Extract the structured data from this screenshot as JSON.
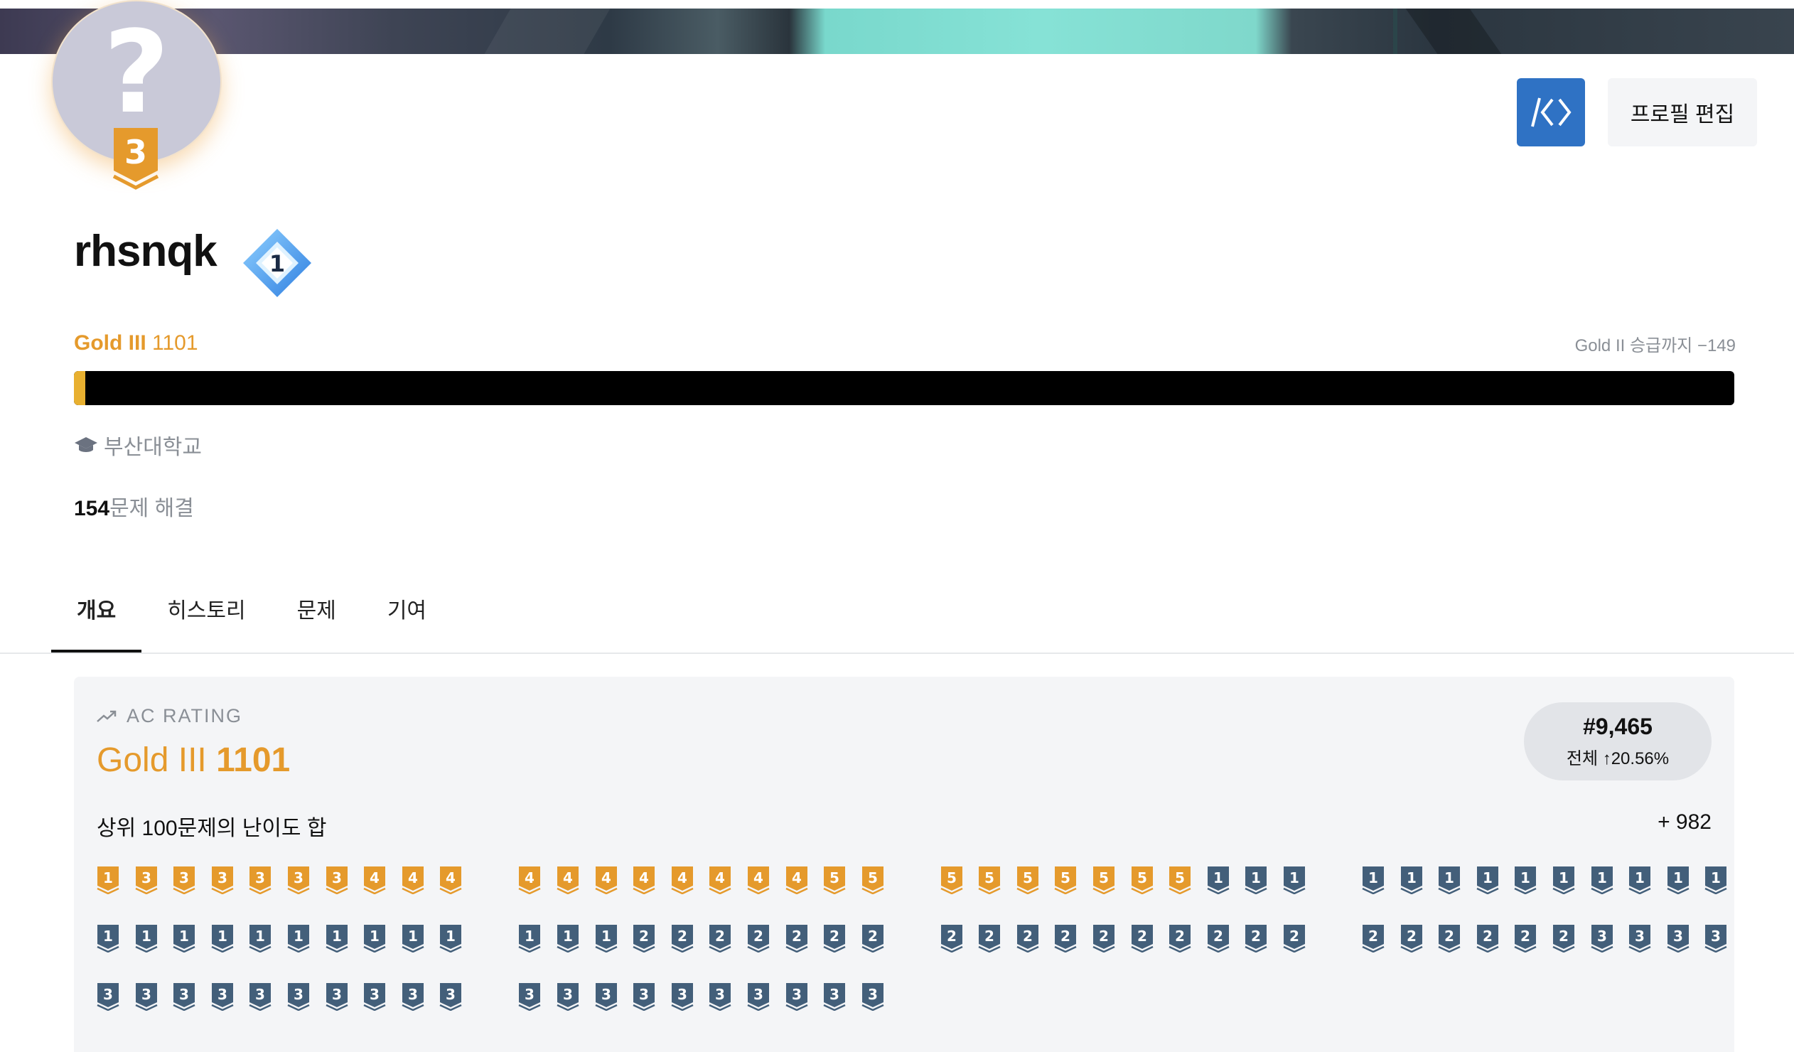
{
  "header": {
    "code_button_glyph": "/<>",
    "edit_profile_label": "프로필 편집",
    "avatar_glyph": "?",
    "avatar_tier_level": "3"
  },
  "profile": {
    "username": "rhsnqk",
    "class_level": "1",
    "tier_name": "Gold III",
    "rating": "1101",
    "next_tier_text": "Gold II 승급까지 −149",
    "progress_fraction": 0.005,
    "school": "부산대학교",
    "solved_count": "154",
    "solved_suffix": "문제 해결"
  },
  "tabs": [
    {
      "label": "개요",
      "active": true
    },
    {
      "label": "히스토리",
      "active": false
    },
    {
      "label": "문제",
      "active": false
    },
    {
      "label": "기여",
      "active": false
    }
  ],
  "ac_card": {
    "section_label": "AC RATING",
    "tier_name": "Gold III",
    "rating": "1101",
    "rank": "#9,465",
    "rank_sub": "전체 ↑20.56%",
    "sum_label": "상위 100문제의 난이도 합",
    "sum_value": "+ 982"
  },
  "colors": {
    "gold": "#e59a2c",
    "silver": "#435f7a",
    "accent_blue": "#2f72c4"
  },
  "badge_rows": [
    [
      [
        [
          "gold",
          "1"
        ],
        [
          "gold",
          "3"
        ],
        [
          "gold",
          "3"
        ],
        [
          "gold",
          "3"
        ],
        [
          "gold",
          "3"
        ],
        [
          "gold",
          "3"
        ],
        [
          "gold",
          "3"
        ],
        [
          "gold",
          "4"
        ],
        [
          "gold",
          "4"
        ],
        [
          "gold",
          "4"
        ]
      ],
      [
        [
          "gold",
          "4"
        ],
        [
          "gold",
          "4"
        ],
        [
          "gold",
          "4"
        ],
        [
          "gold",
          "4"
        ],
        [
          "gold",
          "4"
        ],
        [
          "gold",
          "4"
        ],
        [
          "gold",
          "4"
        ],
        [
          "gold",
          "4"
        ],
        [
          "gold",
          "5"
        ],
        [
          "gold",
          "5"
        ]
      ],
      [
        [
          "gold",
          "5"
        ],
        [
          "gold",
          "5"
        ],
        [
          "gold",
          "5"
        ],
        [
          "gold",
          "5"
        ],
        [
          "gold",
          "5"
        ],
        [
          "gold",
          "5"
        ],
        [
          "gold",
          "5"
        ],
        [
          "silver",
          "1"
        ],
        [
          "silver",
          "1"
        ],
        [
          "silver",
          "1"
        ]
      ],
      [
        [
          "silver",
          "1"
        ],
        [
          "silver",
          "1"
        ],
        [
          "silver",
          "1"
        ],
        [
          "silver",
          "1"
        ],
        [
          "silver",
          "1"
        ],
        [
          "silver",
          "1"
        ],
        [
          "silver",
          "1"
        ],
        [
          "silver",
          "1"
        ],
        [
          "silver",
          "1"
        ],
        [
          "silver",
          "1"
        ]
      ]
    ],
    [
      [
        [
          "silver",
          "1"
        ],
        [
          "silver",
          "1"
        ],
        [
          "silver",
          "1"
        ],
        [
          "silver",
          "1"
        ],
        [
          "silver",
          "1"
        ],
        [
          "silver",
          "1"
        ],
        [
          "silver",
          "1"
        ],
        [
          "silver",
          "1"
        ],
        [
          "silver",
          "1"
        ],
        [
          "silver",
          "1"
        ]
      ],
      [
        [
          "silver",
          "1"
        ],
        [
          "silver",
          "1"
        ],
        [
          "silver",
          "1"
        ],
        [
          "silver",
          "2"
        ],
        [
          "silver",
          "2"
        ],
        [
          "silver",
          "2"
        ],
        [
          "silver",
          "2"
        ],
        [
          "silver",
          "2"
        ],
        [
          "silver",
          "2"
        ],
        [
          "silver",
          "2"
        ]
      ],
      [
        [
          "silver",
          "2"
        ],
        [
          "silver",
          "2"
        ],
        [
          "silver",
          "2"
        ],
        [
          "silver",
          "2"
        ],
        [
          "silver",
          "2"
        ],
        [
          "silver",
          "2"
        ],
        [
          "silver",
          "2"
        ],
        [
          "silver",
          "2"
        ],
        [
          "silver",
          "2"
        ],
        [
          "silver",
          "2"
        ]
      ],
      [
        [
          "silver",
          "2"
        ],
        [
          "silver",
          "2"
        ],
        [
          "silver",
          "2"
        ],
        [
          "silver",
          "2"
        ],
        [
          "silver",
          "2"
        ],
        [
          "silver",
          "2"
        ],
        [
          "silver",
          "3"
        ],
        [
          "silver",
          "3"
        ],
        [
          "silver",
          "3"
        ],
        [
          "silver",
          "3"
        ]
      ]
    ],
    [
      [
        [
          "silver",
          "3"
        ],
        [
          "silver",
          "3"
        ],
        [
          "silver",
          "3"
        ],
        [
          "silver",
          "3"
        ],
        [
          "silver",
          "3"
        ],
        [
          "silver",
          "3"
        ],
        [
          "silver",
          "3"
        ],
        [
          "silver",
          "3"
        ],
        [
          "silver",
          "3"
        ],
        [
          "silver",
          "3"
        ]
      ],
      [
        [
          "silver",
          "3"
        ],
        [
          "silver",
          "3"
        ],
        [
          "silver",
          "3"
        ],
        [
          "silver",
          "3"
        ],
        [
          "silver",
          "3"
        ],
        [
          "silver",
          "3"
        ],
        [
          "silver",
          "3"
        ],
        [
          "silver",
          "3"
        ],
        [
          "silver",
          "3"
        ],
        [
          "silver",
          "3"
        ]
      ]
    ]
  ]
}
